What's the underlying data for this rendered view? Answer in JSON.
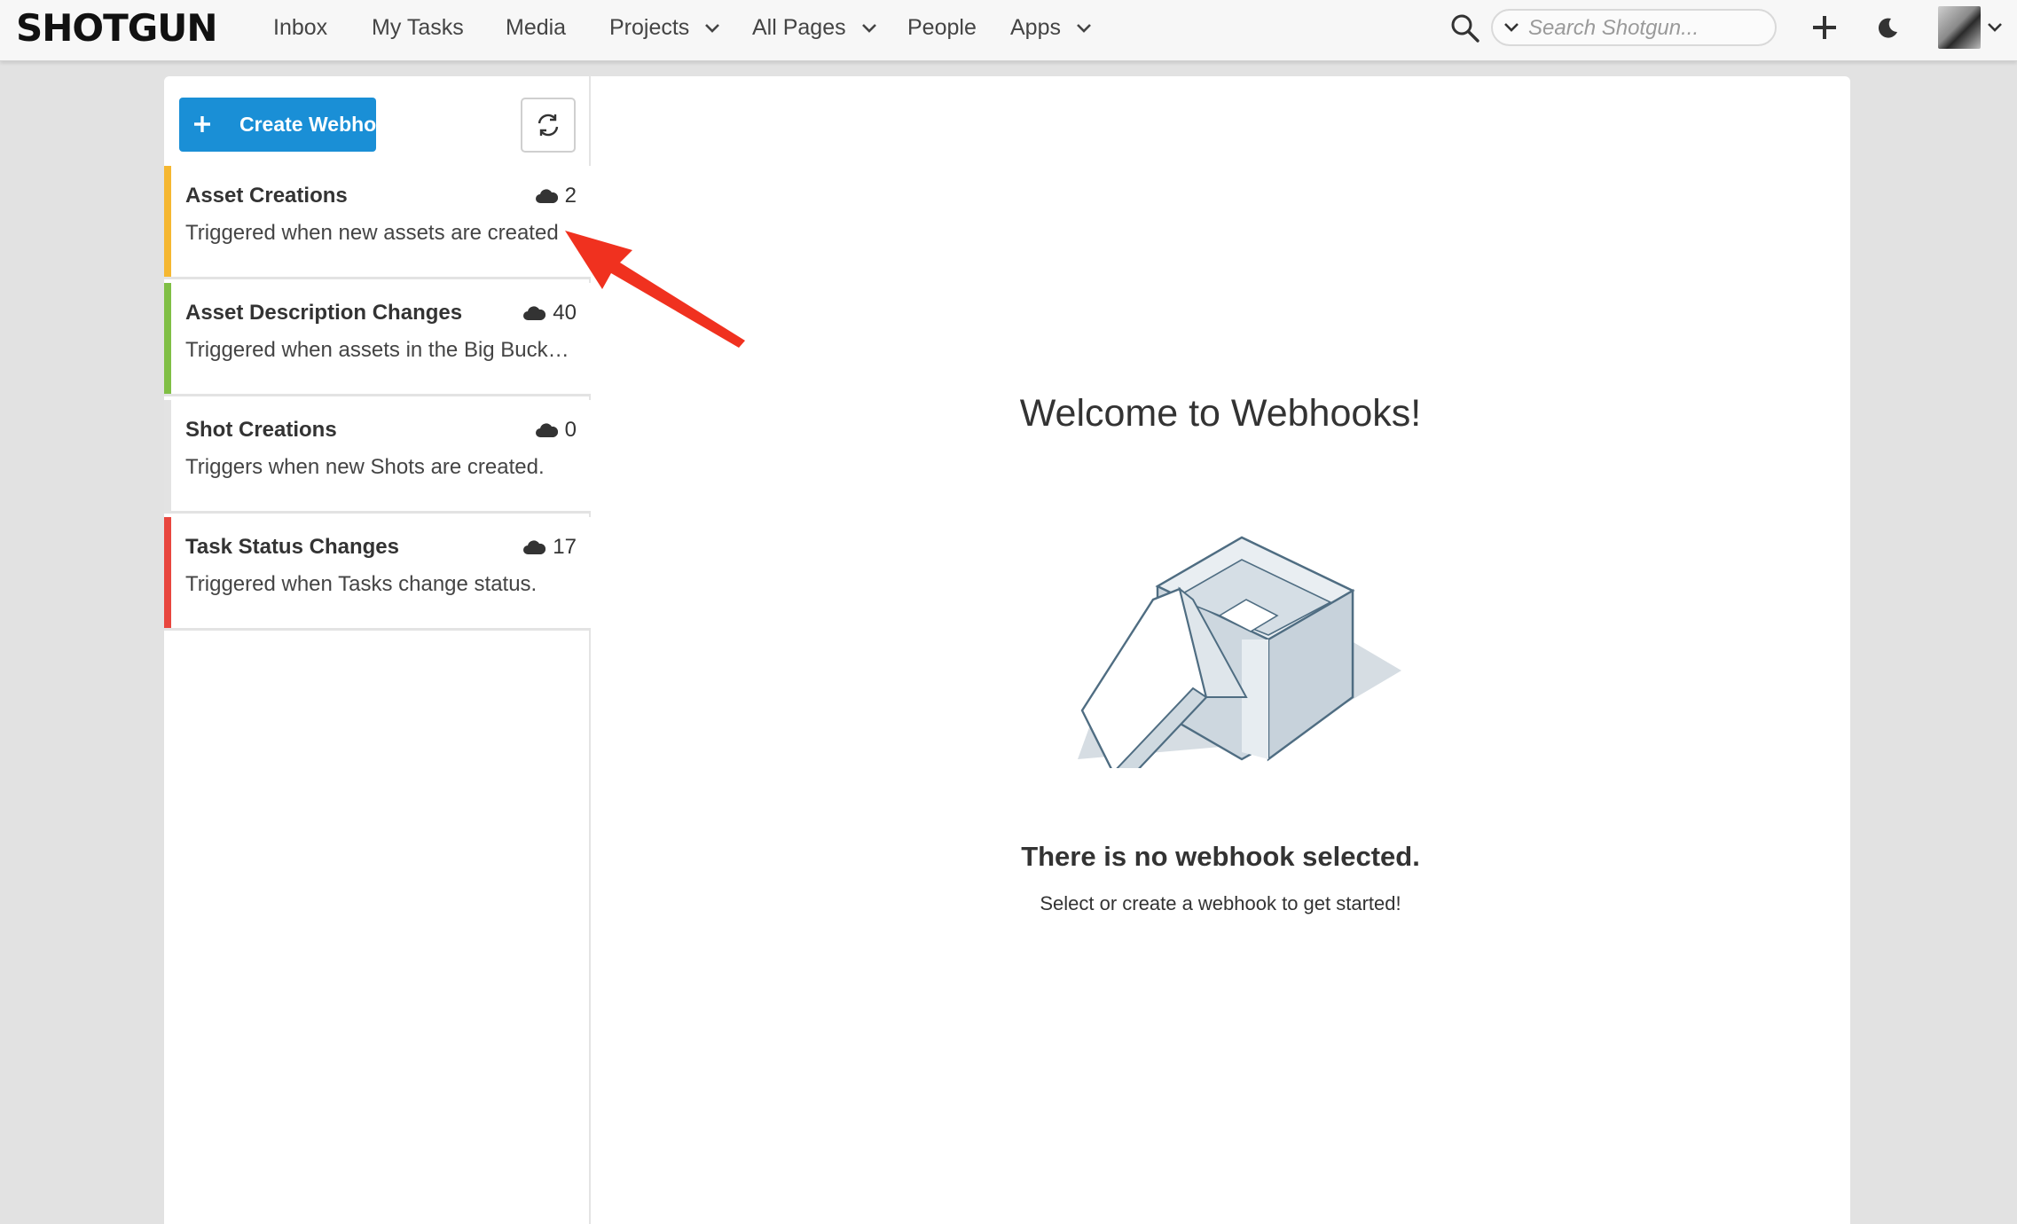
{
  "nav": {
    "logo": "SHOTGUN",
    "items": [
      {
        "label": "Inbox"
      },
      {
        "label": "My Tasks"
      },
      {
        "label": "Media"
      },
      {
        "label": "Projects"
      },
      {
        "label": "All Pages"
      },
      {
        "label": "People"
      },
      {
        "label": "Apps"
      }
    ],
    "search_placeholder": "Search Shotgun..."
  },
  "sidebar": {
    "create_label": "Create Webhook",
    "webhooks": [
      {
        "title": "Asset Creations",
        "description": "Triggered when new assets are created",
        "count": "2",
        "color": "#f5b731"
      },
      {
        "title": "Asset Description Changes",
        "description": "Triggered when assets in the Big Buck Bunny project change",
        "count": "40",
        "color": "#80bf45"
      },
      {
        "title": "Shot Creations",
        "description": "Triggers when new Shots are created.",
        "count": "0",
        "color": "#e3e3e3"
      },
      {
        "title": "Task Status Changes",
        "description": "Triggered when Tasks change status.",
        "count": "17",
        "color": "#e8463e"
      }
    ]
  },
  "main": {
    "welcome": "Welcome to Webhooks!",
    "empty_title": "There is no webhook selected.",
    "empty_subtitle": "Select or create a webhook to get started!"
  },
  "colors": {
    "accent": "#1a8fd6",
    "annotation_arrow": "#f0311f"
  }
}
